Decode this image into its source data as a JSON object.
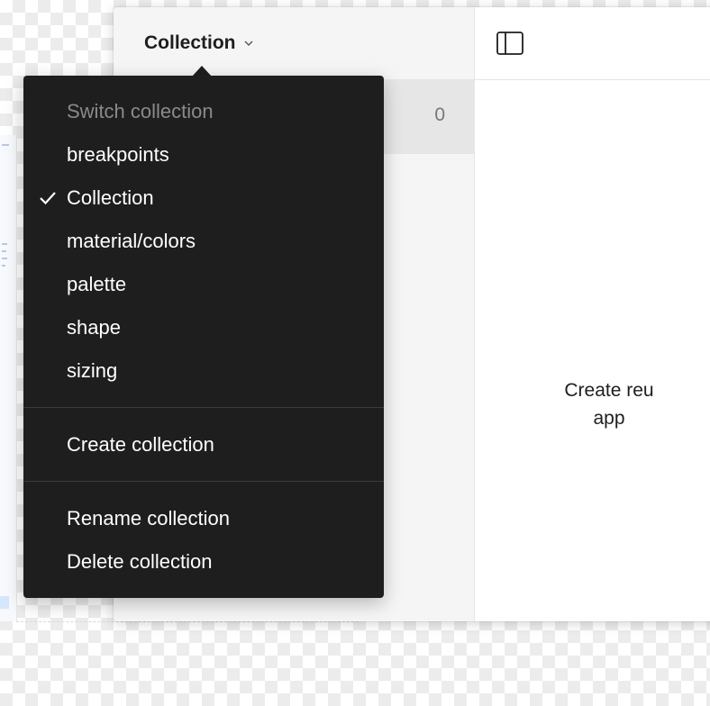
{
  "header": {
    "collection_title": "Collection",
    "chevron_icon": "chevron-down-icon",
    "sidebar_icon": "sidebar-panel-icon"
  },
  "modes": {
    "count": "0"
  },
  "empty_state": {
    "line1": "Create reu",
    "line2": "app"
  },
  "menu": {
    "heading": "Switch collection",
    "collections": [
      {
        "label": "breakpoints",
        "selected": false
      },
      {
        "label": "Collection",
        "selected": true
      },
      {
        "label": "material/colors",
        "selected": false
      },
      {
        "label": "palette",
        "selected": false
      },
      {
        "label": "shape",
        "selected": false
      },
      {
        "label": "sizing",
        "selected": false
      }
    ],
    "create_label": "Create collection",
    "rename_label": "Rename collection",
    "delete_label": "Delete collection",
    "check_icon": "checkmark-icon"
  },
  "colors": {
    "menu_bg": "#1e1e1e",
    "menu_text": "#ffffff",
    "menu_disabled_text": "#8a8a8a",
    "pane_bg": "#f5f5f5",
    "selected_row_bg": "#e6e6e6"
  }
}
